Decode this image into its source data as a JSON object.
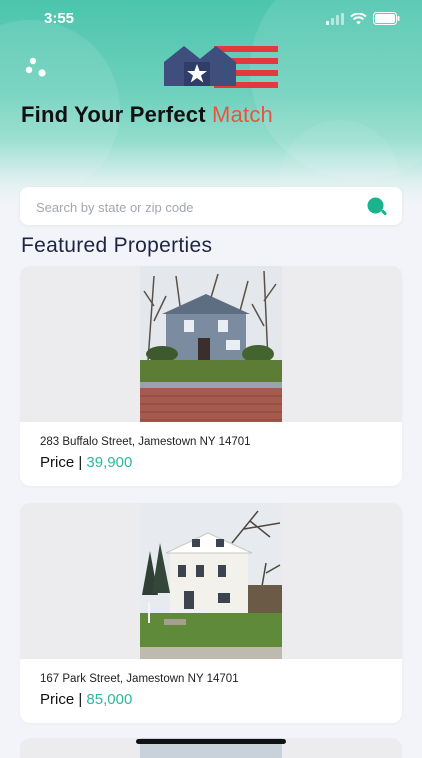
{
  "status": {
    "time": "3:55"
  },
  "header": {
    "headline_main": "Find Your Perfect ",
    "headline_accent": "Match"
  },
  "search": {
    "placeholder": "Search by state or zip code"
  },
  "section": {
    "title": "Featured Properties"
  },
  "properties": [
    {
      "address": "283 Buffalo Street, Jamestown NY 14701",
      "price_label": "Price | ",
      "price": "39,900"
    },
    {
      "address": "167 Park Street, Jamestown NY 14701",
      "price_label": "Price | ",
      "price": "85,000"
    }
  ],
  "colors": {
    "accent": "#e8553e",
    "teal": "#2bb89f",
    "hero": "#4cc5ad",
    "navy": "#1f2442"
  }
}
